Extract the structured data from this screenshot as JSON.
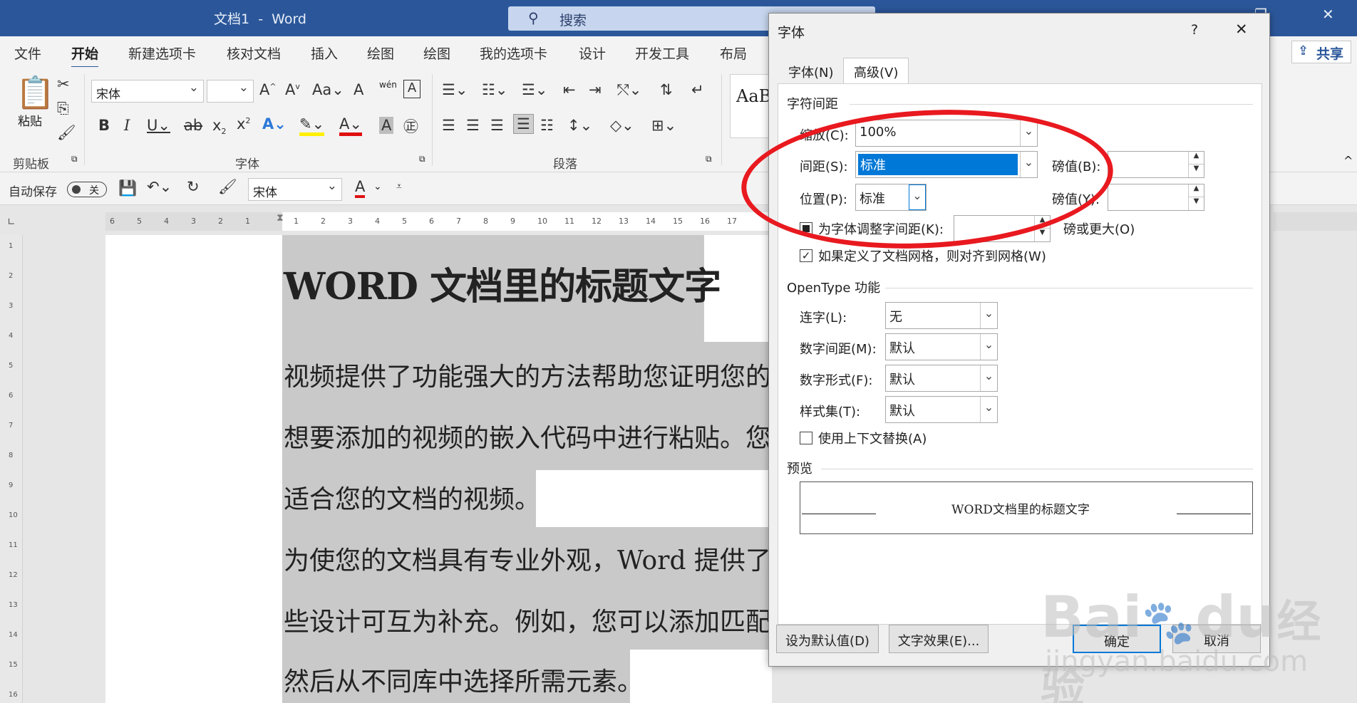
{
  "window": {
    "title": "文档1",
    "app": "Word",
    "separator": "-",
    "search_placeholder": "搜索"
  },
  "menu": {
    "items": [
      "文件",
      "开始",
      "新建选项卡",
      "核对文档",
      "插入",
      "绘图",
      "绘图",
      "我的选项卡",
      "设计",
      "开发工具",
      "布局"
    ],
    "share": "共享"
  },
  "ribbon": {
    "groups": {
      "clipboard": "剪贴板",
      "font": "字体",
      "paragraph": "段落"
    },
    "paste": "粘贴",
    "font_name": "宋体",
    "font_size": "",
    "style_preview": "AaB"
  },
  "qat": {
    "autosave": "自动保存",
    "autosave_state": "关",
    "font_name": "宋体"
  },
  "ruler": {
    "left_numbers": [
      "6",
      "5",
      "4",
      "3",
      "2",
      "1"
    ],
    "right_numbers": [
      "1",
      "2",
      "3",
      "4",
      "5",
      "6",
      "7",
      "8",
      "9",
      "10",
      "11",
      "12",
      "13",
      "14",
      "15",
      "16",
      "17"
    ],
    "vertical_numbers": [
      "1",
      "2",
      "3",
      "4",
      "5",
      "6",
      "7",
      "8",
      "9",
      "10",
      "11",
      "12",
      "13",
      "14",
      "15",
      "16"
    ]
  },
  "document": {
    "title": "WORD 文档里的标题文字",
    "lines": [
      "视频提供了功能强大的方法帮助您证明您的观点",
      "想要添加的视频的嵌入代码中进行粘贴。您也可",
      "适合您的文档的视频。",
      "为使您的文档具有专业外观，Word 提供了页眉",
      "些设计可互为补充。例如，您可以添加匹配的封面",
      "然后从不同库中选择所需元素。"
    ]
  },
  "dialog": {
    "title": "字体",
    "help": "?",
    "close": "✕",
    "tabs": [
      "字体(N)",
      "高级(V)"
    ],
    "active_tab": 1,
    "char_spacing": {
      "heading": "字符间距",
      "scale_label": "缩放(C):",
      "scale_value": "100%",
      "spacing_label": "间距(S):",
      "spacing_value": "标准",
      "pts_b_label": "磅值(B):",
      "pts_b_value": "",
      "position_label": "位置(P):",
      "position_value": "标准",
      "pts_y_label": "磅值(Y):",
      "pts_y_value": "",
      "kerning_label": "为字体调整字间距(K):",
      "kerning_value": "",
      "kerning_unit": "磅或更大(O)",
      "grid_label": "如果定义了文档网格，则对齐到网格(W)"
    },
    "opentype": {
      "heading": "OpenType 功能",
      "ligature_label": "连字(L):",
      "ligature_value": "无",
      "num_spacing_label": "数字间距(M):",
      "num_spacing_value": "默认",
      "num_form_label": "数字形式(F):",
      "num_form_value": "默认",
      "style_set_label": "样式集(T):",
      "style_set_value": "默认",
      "contextual_label": "使用上下文替换(A)"
    },
    "preview": {
      "heading": "预览",
      "text": "WORD文档里的标题文字"
    },
    "buttons": {
      "default": "设为默认值(D)",
      "effects": "文字效果(E)...",
      "ok": "确定",
      "cancel": "取消"
    }
  },
  "watermark": {
    "brand": "Bai",
    "brand2": "du",
    "brand_cn": "经验",
    "url": "jingyan.baidu.com"
  },
  "colors": {
    "word_blue": "#2b579a",
    "annotation_red": "#e8191f",
    "selection_blue": "#0078d7"
  }
}
